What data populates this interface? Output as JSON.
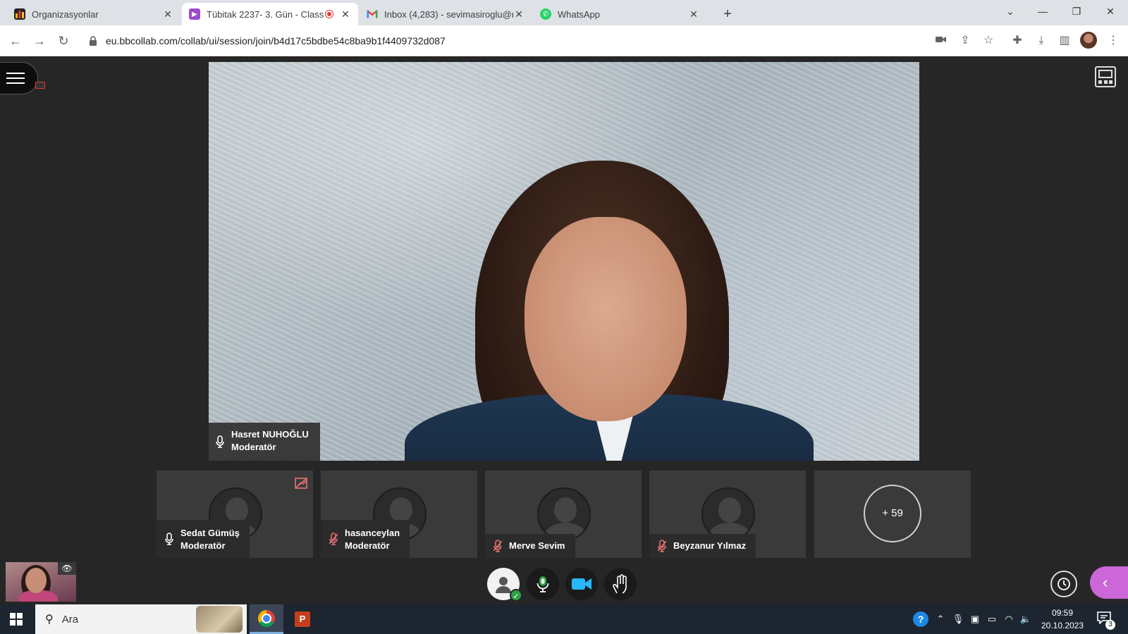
{
  "browser": {
    "tabs": [
      {
        "title": "Organizasyonlar",
        "icon": "chart-favicon-icon"
      },
      {
        "title": "Tübitak 2237- 3. Gün - Class",
        "icon": "collaborate-favicon-icon",
        "recording": true
      },
      {
        "title": "Inbox (4,283) - sevimasiroglu@r",
        "icon": "gmail-favicon-icon"
      },
      {
        "title": "WhatsApp",
        "icon": "whatsapp-favicon-icon"
      }
    ],
    "url": "eu.bbcollab.com/collab/ui/session/join/b4d17c5bdbe54c8ba9b1f4409732d087"
  },
  "session": {
    "main_speaker": {
      "name": "Hasret NUHOĞLU",
      "role": "Moderatör",
      "mic": "on"
    },
    "participants": [
      {
        "name": "Sedat Gümüş",
        "role": "Moderatör",
        "mic": "on",
        "camera_off_badge": true
      },
      {
        "name": "hasanceylan",
        "role": "Moderatör",
        "mic": "muted"
      },
      {
        "name": "Merve Sevim",
        "role": "",
        "mic": "muted"
      },
      {
        "name": "Beyzanur Yılmaz",
        "role": "",
        "mic": "muted"
      }
    ],
    "more_count": "+ 59"
  },
  "controls": {
    "status_icon": "user-status-icon",
    "mic_icon": "microphone-icon",
    "camera_icon": "video-camera-icon",
    "hand_icon": "raise-hand-icon"
  },
  "colors": {
    "accent_panel": "#cc67d8",
    "mic_active": "#2ea043",
    "camera_active": "#29b6f6",
    "muted": "#e57373"
  },
  "taskbar": {
    "search_placeholder": "Ara",
    "time": "09:59",
    "date": "20.10.2023",
    "notifications": "3"
  }
}
